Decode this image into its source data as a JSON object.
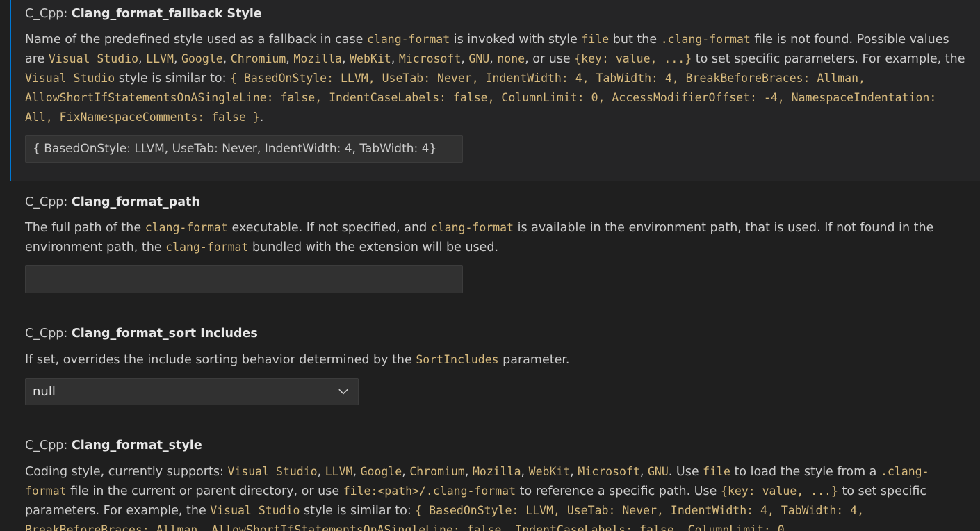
{
  "settings": [
    {
      "category": "C_Cpp: ",
      "name": "Clang_format_fallback Style",
      "description": [
        {
          "t": "Name of the predefined style used as a fallback in case "
        },
        {
          "t": "clang-format",
          "c": true
        },
        {
          "t": " is invoked with style "
        },
        {
          "t": "file",
          "c": true
        },
        {
          "t": " but the "
        },
        {
          "t": ".clang-format",
          "c": true
        },
        {
          "t": " file is not found. Possible values are "
        },
        {
          "t": "Visual Studio",
          "c": true
        },
        {
          "t": ", "
        },
        {
          "t": "LLVM",
          "c": true
        },
        {
          "t": ", "
        },
        {
          "t": "Google",
          "c": true
        },
        {
          "t": ", "
        },
        {
          "t": "Chromium",
          "c": true
        },
        {
          "t": ", "
        },
        {
          "t": "Mozilla",
          "c": true
        },
        {
          "t": ", "
        },
        {
          "t": "WebKit",
          "c": true
        },
        {
          "t": ", "
        },
        {
          "t": "Microsoft",
          "c": true
        },
        {
          "t": ", "
        },
        {
          "t": "GNU",
          "c": true
        },
        {
          "t": ", "
        },
        {
          "t": "none",
          "c": true
        },
        {
          "t": ", or use "
        },
        {
          "t": "{key: value, ...}",
          "c": true
        },
        {
          "t": " to set specific parameters. For example, the "
        },
        {
          "t": "Visual Studio",
          "c": true
        },
        {
          "t": " style is similar to: "
        },
        {
          "t": "{ BasedOnStyle: LLVM, UseTab: Never, IndentWidth: 4, TabWidth: 4, BreakBeforeBraces: Allman, AllowShortIfStatementsOnASingleLine: false, IndentCaseLabels: false, ColumnLimit: 0, AccessModifierOffset: -4, NamespaceIndentation: All, FixNamespaceComments: false }",
          "c": true
        },
        {
          "t": "."
        }
      ],
      "value": "{ BasedOnStyle: LLVM, UseTab: Never, IndentWidth: 4, TabWidth: 4}"
    },
    {
      "category": "C_Cpp: ",
      "name": "Clang_format_path",
      "description": [
        {
          "t": "The full path of the "
        },
        {
          "t": "clang-format",
          "c": true
        },
        {
          "t": " executable. If not specified, and "
        },
        {
          "t": "clang-format",
          "c": true
        },
        {
          "t": " is available in the environment path, that is used. If not found in the environment path, the "
        },
        {
          "t": "clang-format",
          "c": true
        },
        {
          "t": " bundled with the extension will be used."
        }
      ],
      "value": ""
    },
    {
      "category": "C_Cpp: ",
      "name": "Clang_format_sort Includes",
      "description": [
        {
          "t": "If set, overrides the include sorting behavior determined by the "
        },
        {
          "t": "SortIncludes",
          "c": true
        },
        {
          "t": " parameter."
        }
      ],
      "value": "null"
    },
    {
      "category": "C_Cpp: ",
      "name": "Clang_format_style",
      "description": [
        {
          "t": "Coding style, currently supports: "
        },
        {
          "t": "Visual Studio",
          "c": true
        },
        {
          "t": ", "
        },
        {
          "t": "LLVM",
          "c": true
        },
        {
          "t": ", "
        },
        {
          "t": "Google",
          "c": true
        },
        {
          "t": ", "
        },
        {
          "t": "Chromium",
          "c": true
        },
        {
          "t": ", "
        },
        {
          "t": "Mozilla",
          "c": true
        },
        {
          "t": ", "
        },
        {
          "t": "WebKit",
          "c": true
        },
        {
          "t": ", "
        },
        {
          "t": "Microsoft",
          "c": true
        },
        {
          "t": ", "
        },
        {
          "t": "GNU",
          "c": true
        },
        {
          "t": ". Use "
        },
        {
          "t": "file",
          "c": true
        },
        {
          "t": " to load the style from a "
        },
        {
          "t": ".clang-format",
          "c": true
        },
        {
          "t": " file in the current or parent directory, or use "
        },
        {
          "t": "file:<path>/.clang-format",
          "c": true
        },
        {
          "t": " to reference a specific path. Use "
        },
        {
          "t": "{key: value, ...}",
          "c": true
        },
        {
          "t": " to set specific parameters. For example, the "
        },
        {
          "t": "Visual Studio",
          "c": true
        },
        {
          "t": " style is similar to: "
        },
        {
          "t": "{ BasedOnStyle: LLVM, UseTab: Never, IndentWidth: 4, TabWidth: 4, BreakBeforeBraces: Allman, AllowShortIfStatementsOnASingleLine: false, IndentCaseLabels: false, ColumnLimit: 0,",
          "c": true
        }
      ]
    }
  ],
  "colors": {
    "background": "#1f1f1f",
    "focused_row": "#252526",
    "focus_border": "#0078d4",
    "code_text": "#d7ba7d",
    "input_bg": "#313131"
  },
  "icons": {
    "dropdown": "chevron-down-icon"
  }
}
